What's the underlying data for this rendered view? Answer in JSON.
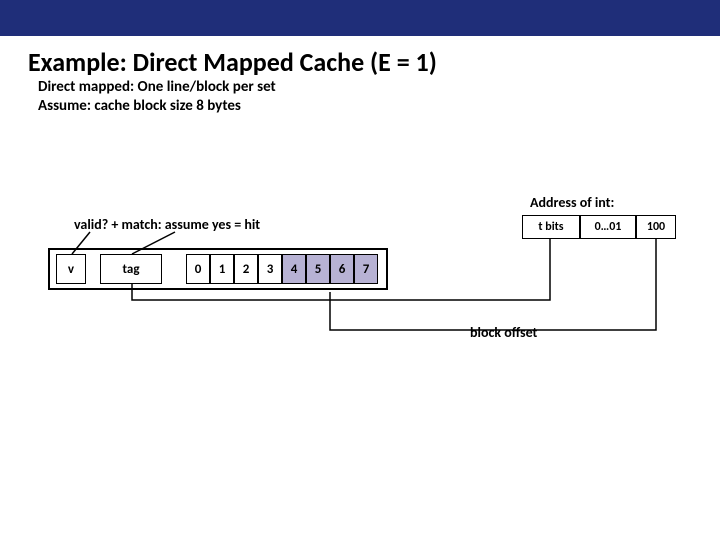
{
  "title": "Example: Direct Mapped Cache (E = 1)",
  "sub1": "Direct mapped: One line/block per set",
  "sub2": "Assume: cache block size 8 bytes",
  "hit_line": "valid?   +   match: assume yes = hit",
  "addr_heading": "Address of int:",
  "addr": {
    "t": "t bits",
    "s": "0…01",
    "b": "100"
  },
  "cache": {
    "v": "v",
    "tag": "tag",
    "bytes": [
      "0",
      "1",
      "2",
      "3",
      "4",
      "5",
      "6",
      "7"
    ]
  },
  "block_offset": "block offset"
}
